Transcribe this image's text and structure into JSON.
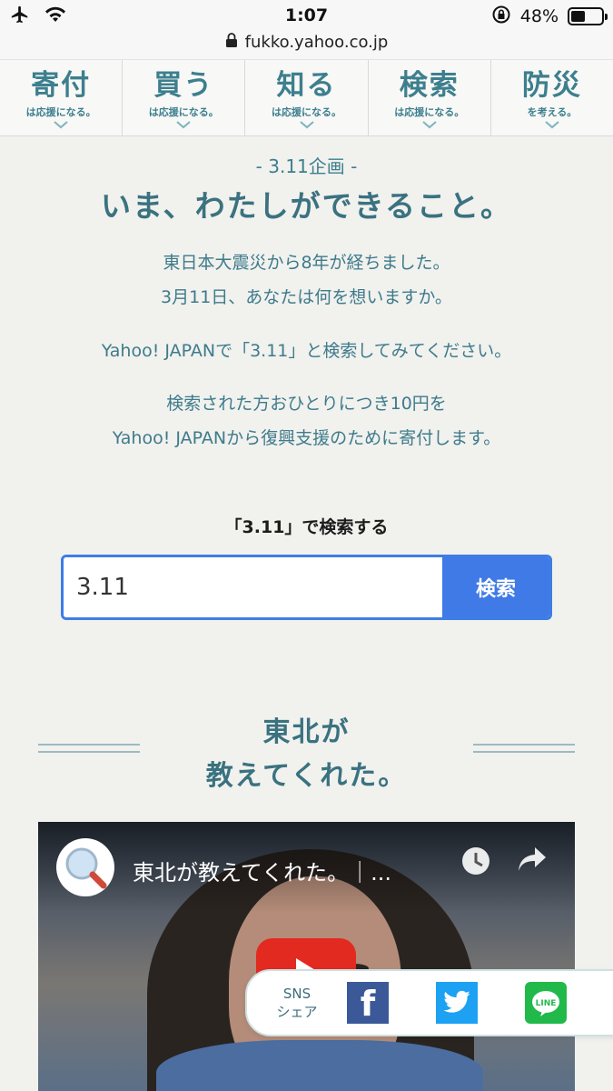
{
  "status": {
    "time": "1:07",
    "battery_text": "48%",
    "battery_level": 0.48,
    "url": "fukko.yahoo.co.jp"
  },
  "nav": [
    {
      "title": "寄付",
      "sub": "は応援になる。"
    },
    {
      "title": "買う",
      "sub": "は応援になる。"
    },
    {
      "title": "知る",
      "sub": "は応援になる。"
    },
    {
      "title": "検索",
      "sub": "は応援になる。"
    },
    {
      "title": "防災",
      "sub": "を考える。"
    }
  ],
  "intro": {
    "campaign": "- 3.11企画 -",
    "headline": "いま、わたしができること。",
    "p1_line1": "東日本大震災から8年が経ちました。",
    "p1_line2": "3月11日、あなたは何を想いますか。",
    "p2": "Yahoo! JAPANで「3.11」と検索してみてください。",
    "p3_line1": "検索された方おひとりにつき10円を",
    "p3_line2": "Yahoo! JAPANから復興支援のために寄付します。"
  },
  "search": {
    "label": "「3.11」で検索する",
    "value": "3.11",
    "button": "検索"
  },
  "section": {
    "title_line1": "東北が",
    "title_line2": "教えてくれた。"
  },
  "video": {
    "title": "東北が教えてくれた。｜..."
  },
  "share": {
    "label_line1": "SNS",
    "label_line2": "シェア",
    "facebook_glyph": "f"
  },
  "colors": {
    "accent": "#3d7f8e",
    "search_blue": "#3f7ae6",
    "facebook": "#3b5998",
    "twitter": "#1da1f2",
    "line": "#22b94b"
  }
}
